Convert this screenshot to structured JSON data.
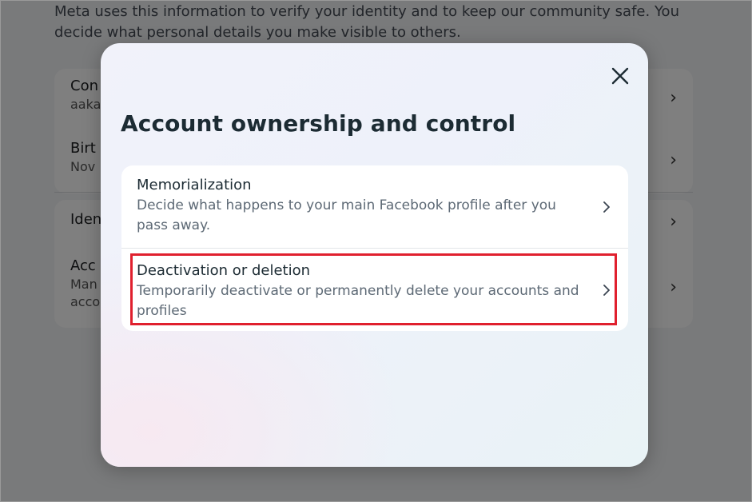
{
  "background_page": {
    "intro": "Meta uses this information to verify your identity and to keep our community safe. You decide what personal details you make visible to others.",
    "rows": [
      {
        "title": "Con",
        "sub": "aaka"
      },
      {
        "title": "Birt",
        "sub": "Nov"
      },
      {
        "title": "Iden",
        "sub": ""
      },
      {
        "title": "Acc",
        "sub": "Man",
        "sub2": "acco"
      }
    ]
  },
  "modal": {
    "title": "Account ownership and control",
    "options": [
      {
        "title": "Memorialization",
        "description": "Decide what happens to your main Facebook profile after you pass away."
      },
      {
        "title": "Deactivation or deletion",
        "description": "Temporarily deactivate or permanently delete your accounts and profiles"
      }
    ]
  },
  "colors": {
    "highlight": "#e0202e",
    "title": "#1c2b33",
    "description": "#5d6975"
  },
  "icons": {
    "close": "close-icon",
    "chevron": "chevron-right-icon"
  }
}
